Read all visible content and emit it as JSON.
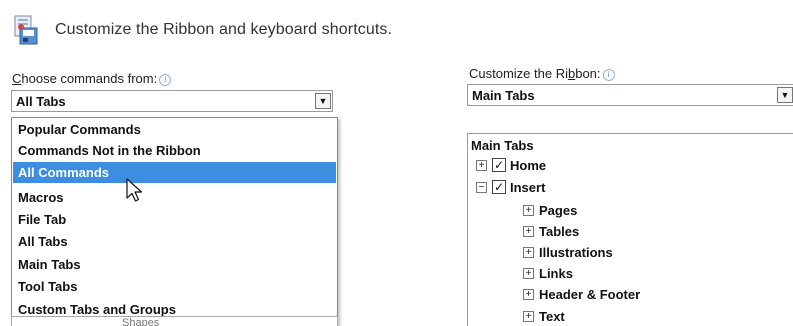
{
  "header": {
    "title": "Customize the Ribbon and keyboard shortcuts."
  },
  "choose_commands": {
    "label_pre": "",
    "label_access_key": "C",
    "label_post": "hoose commands from:",
    "info_glyph": "i",
    "selected_value": "All Tabs",
    "dropdown_items": [
      "Popular Commands",
      "Commands Not in the Ribbon",
      "All Commands",
      "Macros",
      "File Tab",
      "All Tabs",
      "Main Tabs",
      "Tool Tabs",
      "Custom Tabs and Groups"
    ],
    "highlighted_item": "All Commands",
    "partial_list_text": "Shapes"
  },
  "customize_ribbon": {
    "label_pre": "Customize the Ri",
    "label_access_key": "b",
    "label_post": "bon:",
    "info_glyph": "i",
    "selected_value": "Main Tabs",
    "tree_title": "Main Tabs",
    "tree": [
      {
        "label": "Home",
        "expander": "+",
        "checked": true,
        "level": 0
      },
      {
        "label": "Insert",
        "expander": "−",
        "checked": true,
        "level": 0
      },
      {
        "label": "Pages",
        "expander": "+",
        "level": 1
      },
      {
        "label": "Tables",
        "expander": "+",
        "level": 1
      },
      {
        "label": "Illustrations",
        "expander": "+",
        "level": 1
      },
      {
        "label": "Links",
        "expander": "+",
        "level": 1
      },
      {
        "label": "Header & Footer",
        "expander": "+",
        "level": 1
      },
      {
        "label": "Text",
        "expander": "+",
        "level": 1
      }
    ]
  },
  "glyphs": {
    "dropdown_arrow": "▼",
    "check": "✓"
  },
  "colors": {
    "selection": "#3d8ee0",
    "info_icon": "#5a8fc7"
  }
}
